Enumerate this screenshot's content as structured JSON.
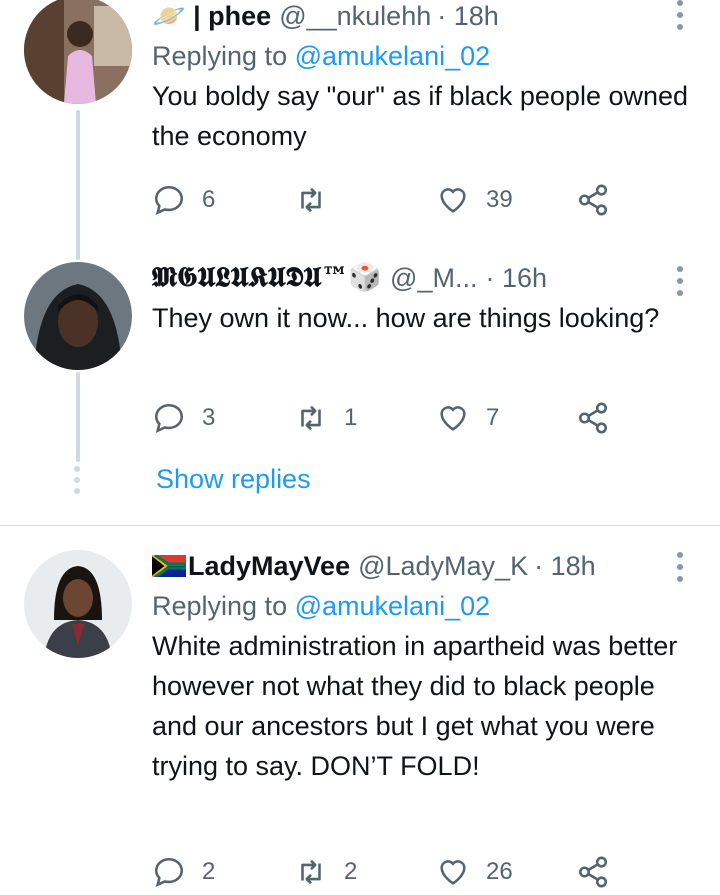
{
  "tweets": [
    {
      "display_name": "🪐 | phee",
      "handle": "@__nkulehh",
      "time": "· 18h",
      "replying_label": "Replying to",
      "replying_handle": "@amukelani_02",
      "text": "You boldy say \"our\" as if black people owned the economy",
      "replies": "6",
      "retweets": "",
      "likes": "39"
    },
    {
      "display_name": "𝕸𝕲𝖀𝕷𝖀𝕶𝖀𝕯𝖀™🎲",
      "handle": "@_M...",
      "time": "· 16h",
      "text": "They own it now... how are things looking?",
      "replies": "3",
      "retweets": "1",
      "likes": "7"
    },
    {
      "display_name": "LadyMayVee",
      "handle": "@LadyMay_K",
      "time": "· 18h",
      "replying_label": "Replying to",
      "replying_handle": "@amukelani_02",
      "text": "White administration in apartheid was better however not what they did to black people and our ancestors but I get what you were trying to say. DON’T FOLD!",
      "replies": "2",
      "retweets": "2",
      "likes": "26"
    }
  ],
  "show_replies": "Show replies",
  "colors": {
    "accent": "#1d9bf0",
    "muted": "#536471",
    "line": "#cfd9de"
  }
}
